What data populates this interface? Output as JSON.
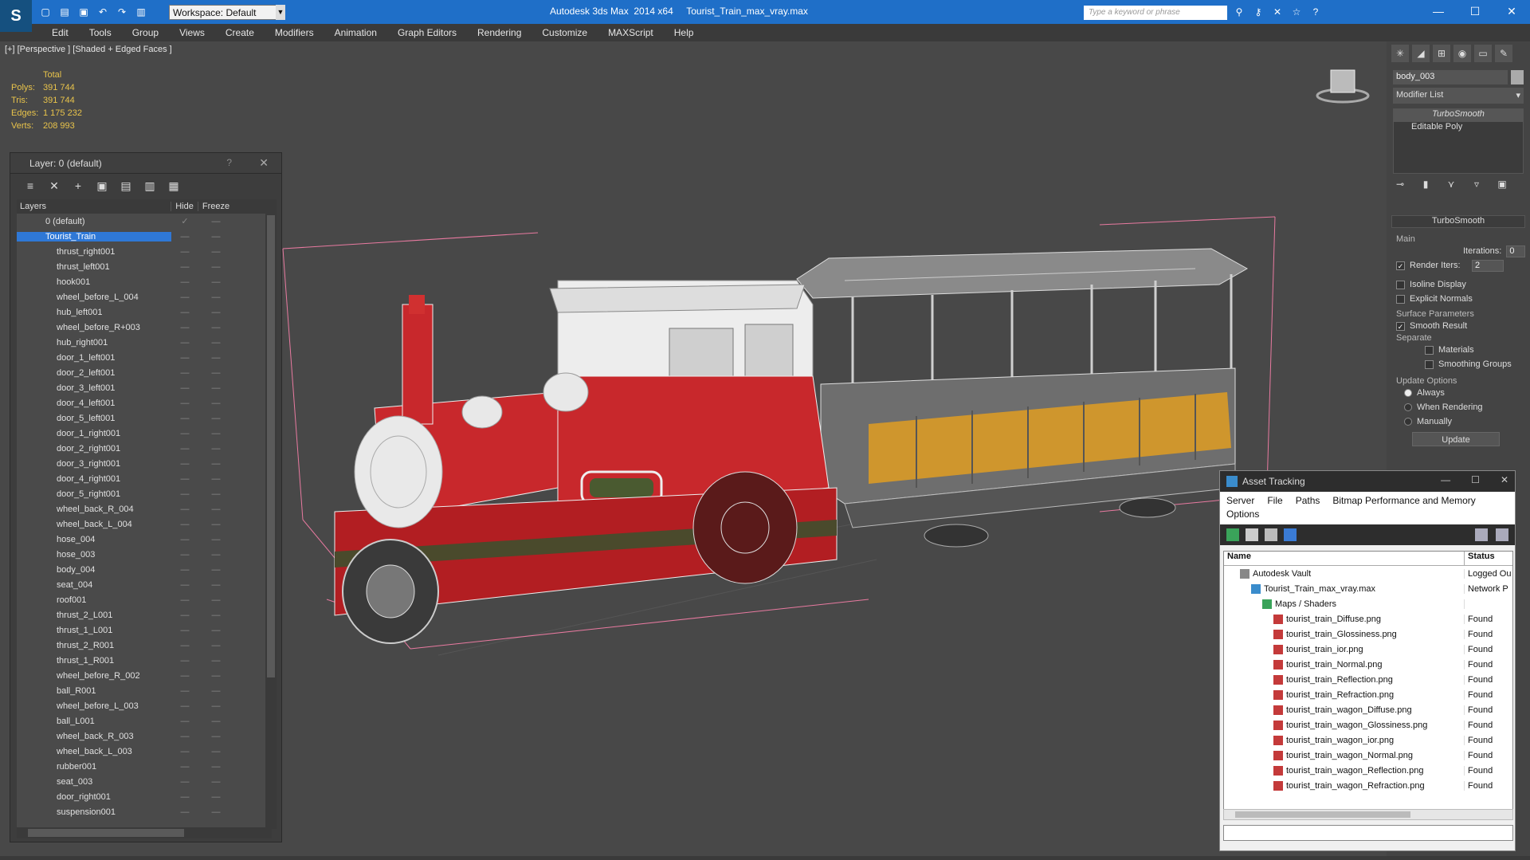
{
  "app": {
    "title": "Autodesk 3ds Max  2014 x64     Tourist_Train_max_vray.max",
    "workspace": "Workspace: Default",
    "search_placeholder": "Type a keyword or phrase"
  },
  "menu": [
    "Edit",
    "Tools",
    "Group",
    "Views",
    "Create",
    "Modifiers",
    "Animation",
    "Graph Editors",
    "Rendering",
    "Customize",
    "MAXScript",
    "Help"
  ],
  "viewport": {
    "label": "[+] [Perspective ] [Shaded + Edged Faces ]",
    "stats": {
      "header": "Total",
      "rows": [
        {
          "k": "Polys:",
          "v": "391 744"
        },
        {
          "k": "Tris:",
          "v": "391 744"
        },
        {
          "k": "Edges:",
          "v": "1 175 232"
        },
        {
          "k": "Verts:",
          "v": "208 993"
        }
      ]
    }
  },
  "layer_panel": {
    "title": "Layer: 0 (default)",
    "help": "?",
    "columns": {
      "name": "Layers",
      "hide": "Hide",
      "freeze": "Freeze"
    },
    "rows": [
      {
        "name": "0 (default)",
        "level": 0,
        "checked": true
      },
      {
        "name": "Tourist_Train",
        "level": 0,
        "selected": true
      },
      {
        "name": "thrust_right001"
      },
      {
        "name": "thrust_left001"
      },
      {
        "name": "hook001"
      },
      {
        "name": "wheel_before_L_004"
      },
      {
        "name": "hub_left001"
      },
      {
        "name": "wheel_before_R+003"
      },
      {
        "name": "hub_right001"
      },
      {
        "name": "door_1_left001"
      },
      {
        "name": "door_2_left001"
      },
      {
        "name": "door_3_left001"
      },
      {
        "name": "door_4_left001"
      },
      {
        "name": "door_5_left001"
      },
      {
        "name": "door_1_right001"
      },
      {
        "name": "door_2_right001"
      },
      {
        "name": "door_3_right001"
      },
      {
        "name": "door_4_right001"
      },
      {
        "name": "door_5_right001"
      },
      {
        "name": "wheel_back_R_004"
      },
      {
        "name": "wheel_back_L_004"
      },
      {
        "name": "hose_004"
      },
      {
        "name": "hose_003"
      },
      {
        "name": "body_004"
      },
      {
        "name": "seat_004"
      },
      {
        "name": "roof001"
      },
      {
        "name": "thrust_2_L001"
      },
      {
        "name": "thrust_1_L001"
      },
      {
        "name": "thrust_2_R001"
      },
      {
        "name": "thrust_1_R001"
      },
      {
        "name": "wheel_before_R_002"
      },
      {
        "name": "ball_R001"
      },
      {
        "name": "wheel_before_L_003"
      },
      {
        "name": "ball_L001"
      },
      {
        "name": "wheel_back_R_003"
      },
      {
        "name": "wheel_back_L_003"
      },
      {
        "name": "rubber001"
      },
      {
        "name": "seat_003"
      },
      {
        "name": "door_right001"
      },
      {
        "name": "suspension001"
      }
    ]
  },
  "command_panel": {
    "object_name": "body_003",
    "modifier_list": "Modifier List",
    "stack": [
      "TurboSmooth",
      "Editable Poly"
    ],
    "rollout": {
      "title": "TurboSmooth",
      "main": "Main",
      "iterations_label": "Iterations:",
      "iterations": "0",
      "render_iters_label": "Render Iters:",
      "render_iters": "2",
      "isoline": "Isoline Display",
      "explicit": "Explicit Normals",
      "surface": "Surface Parameters",
      "smooth_result": "Smooth Result",
      "separate": "Separate",
      "materials": "Materials",
      "smoothing_groups": "Smoothing Groups",
      "update_options": "Update Options",
      "always": "Always",
      "when_rendering": "When Rendering",
      "manually": "Manually",
      "update_button": "Update"
    }
  },
  "asset_tracking": {
    "title": "Asset Tracking",
    "menu": [
      "Server",
      "File",
      "Paths",
      "Bitmap Performance and Memory"
    ],
    "menu2": "Options",
    "columns": {
      "name": "Name",
      "status": "Status"
    },
    "rows": [
      {
        "name": "Autodesk Vault",
        "status": "Logged Ou",
        "indent": 1
      },
      {
        "name": "Tourist_Train_max_vray.max",
        "status": "Network P",
        "indent": 2
      },
      {
        "name": "Maps / Shaders",
        "status": "",
        "indent": 3
      },
      {
        "name": "tourist_train_Diffuse.png",
        "status": "Found",
        "indent": 4
      },
      {
        "name": "tourist_train_Glossiness.png",
        "status": "Found",
        "indent": 4
      },
      {
        "name": "tourist_train_ior.png",
        "status": "Found",
        "indent": 4
      },
      {
        "name": "tourist_train_Normal.png",
        "status": "Found",
        "indent": 4
      },
      {
        "name": "tourist_train_Reflection.png",
        "status": "Found",
        "indent": 4
      },
      {
        "name": "tourist_train_Refraction.png",
        "status": "Found",
        "indent": 4
      },
      {
        "name": "tourist_train_wagon_Diffuse.png",
        "status": "Found",
        "indent": 4
      },
      {
        "name": "tourist_train_wagon_Glossiness.png",
        "status": "Found",
        "indent": 4
      },
      {
        "name": "tourist_train_wagon_ior.png",
        "status": "Found",
        "indent": 4
      },
      {
        "name": "tourist_train_wagon_Normal.png",
        "status": "Found",
        "indent": 4
      },
      {
        "name": "tourist_train_wagon_Reflection.png",
        "status": "Found",
        "indent": 4
      },
      {
        "name": "tourist_train_wagon_Refraction.png",
        "status": "Found",
        "indent": 4
      }
    ]
  },
  "colors": {
    "titlebar": "#1f6fc8",
    "selection": "#2f78d6",
    "stats": "#e8c34b",
    "train_red": "#c8282c",
    "wagon_yellow": "#e0a020"
  }
}
